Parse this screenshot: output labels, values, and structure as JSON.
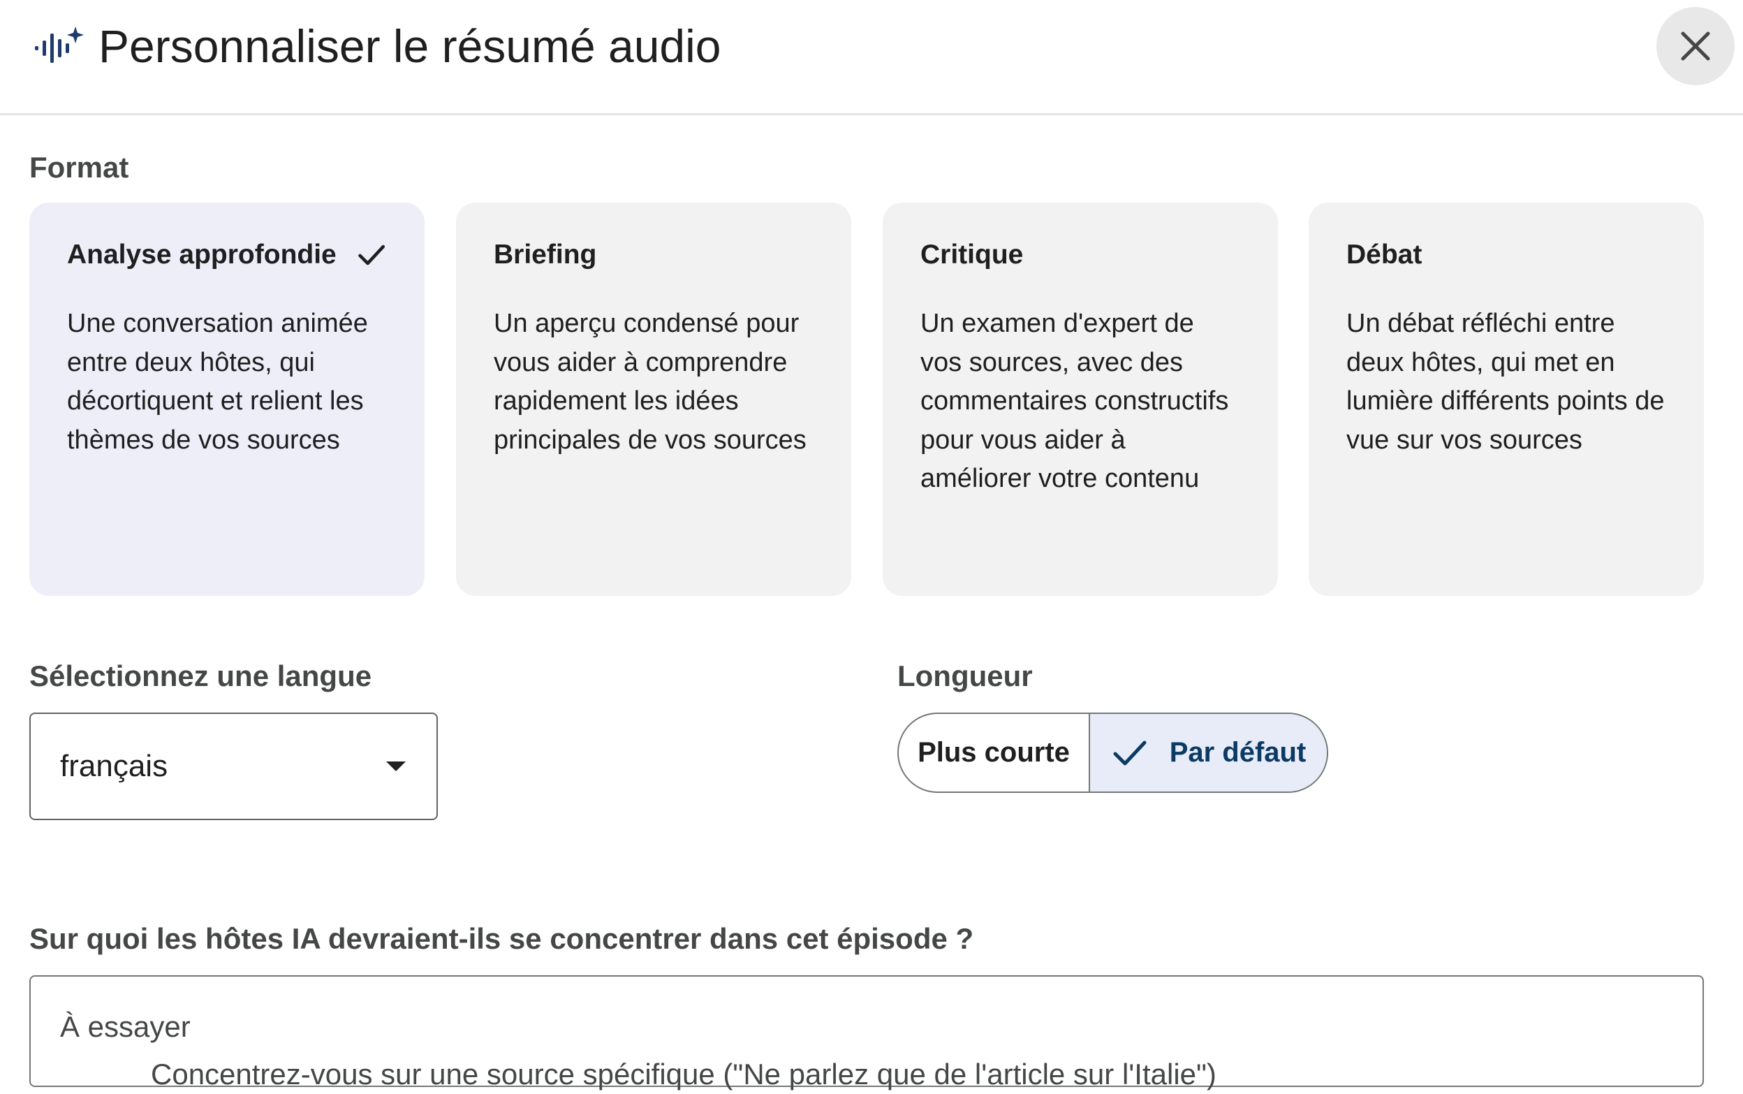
{
  "dialog": {
    "title": "Personnaliser le résumé audio",
    "icon": "audio-sparkle-icon",
    "close_icon": "close-icon"
  },
  "format": {
    "label": "Format",
    "selected": "Analyse approfondie",
    "options": [
      {
        "title": "Analyse approfondie",
        "description": "Une conversation animée entre deux hôtes, qui décortiquent et relient les thèmes de vos sources"
      },
      {
        "title": "Briefing",
        "description": "Un aperçu condensé pour vous aider à comprendre rapidement les idées principales de vos sources"
      },
      {
        "title": "Critique",
        "description": "Un examen d'expert de vos sources, avec des commentaires constructifs pour vous aider à améliorer votre contenu"
      },
      {
        "title": "Débat",
        "description": "Un débat réfléchi entre deux hôtes, qui met en lumière différents points de vue sur vos sources"
      }
    ]
  },
  "language": {
    "label": "Sélectionnez une langue",
    "value": "français"
  },
  "length": {
    "label": "Longueur",
    "options": [
      "Plus courte",
      "Par défaut"
    ],
    "selected": "Par défaut"
  },
  "focus": {
    "label": "Sur quoi les hôtes IA devraient-ils se concentrer dans cet épisode ?",
    "hint_title": "À essayer",
    "hint_line": "Concentrez-vous sur une source spécifique (\"Ne parlez que de l'article sur l'Italie\")"
  },
  "colors": {
    "selected_card": "#eeeef9",
    "card": "#f2f2f2",
    "selected_segment": "#e8ecf8",
    "accent_text": "#0b3a64"
  }
}
